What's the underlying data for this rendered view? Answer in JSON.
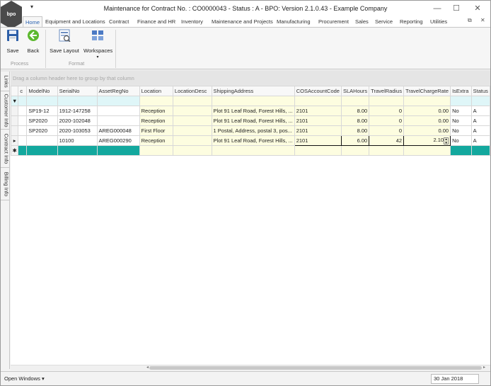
{
  "window": {
    "title": "Maintenance for Contract No. : CO0000043 - Status : A - BPO: Version 2.1.0.43 - Example Company",
    "logo_text": "bpo",
    "minimize_glyph": "—",
    "maximize_glyph": "☐",
    "close_glyph": "✕",
    "qat_glyph": "▾"
  },
  "ribbon_tabs": [
    {
      "label": "Home"
    },
    {
      "label": "Equipment and Locations"
    },
    {
      "label": "Contract"
    },
    {
      "label": "Finance and HR"
    },
    {
      "label": "Inventory"
    },
    {
      "label": "Maintenance and Projects"
    },
    {
      "label": "Manufacturing"
    },
    {
      "label": "Procurement"
    },
    {
      "label": "Sales"
    },
    {
      "label": "Service"
    },
    {
      "label": "Reporting"
    },
    {
      "label": "Utilities"
    }
  ],
  "ribbon_right": {
    "restore_glyph": "⧉",
    "close_glyph": "✕"
  },
  "ribbon": {
    "save_label": "Save",
    "back_label": "Back",
    "save_layout_label": "Save Layout",
    "workspaces_label": "Workspaces",
    "workspaces_glyph": "▾",
    "group_process": "Process",
    "group_format": "Format"
  },
  "side_tabs": [
    {
      "label": "Links"
    },
    {
      "label": "Customer Info"
    },
    {
      "label": "Contract Info"
    },
    {
      "label": "Billing Info"
    }
  ],
  "grid": {
    "group_hint": "Drag a column header here to group by that column",
    "filter_icon": "▼",
    "headers": {
      "c": "c",
      "model": "ModelNo",
      "serial": "SerialNo",
      "asset": "AssetRegNo",
      "location": "Location",
      "locdesc": "LocationDesc",
      "shipping": "ShippingAddress",
      "cos": "COSAccountCode",
      "sla": "SLAHours",
      "radius": "TravelRadius",
      "rate": "TravelChargeRate",
      "extra": "IsExtra",
      "status": "Status"
    },
    "rows": [
      {
        "indicator": "",
        "model": "SP19-12",
        "serial": "1912-147258",
        "asset": "",
        "location": "Reception",
        "locdesc": "",
        "shipping": "Plot 91 Leaf Road, Forest Hills, ...",
        "cos": "2101",
        "sla": "8.00",
        "radius": "0",
        "rate": "0.00",
        "extra": "No",
        "status": "A"
      },
      {
        "indicator": "",
        "model": "SP2020",
        "serial": "2020-102048",
        "asset": "",
        "location": "Reception",
        "locdesc": "",
        "shipping": "Plot 91 Leaf Road, Forest Hills, ...",
        "cos": "2101",
        "sla": "8.00",
        "radius": "0",
        "rate": "0.00",
        "extra": "No",
        "status": "A"
      },
      {
        "indicator": "",
        "model": "SP2020",
        "serial": "2020-103053",
        "asset": "AREG000048",
        "location": "First Floor",
        "locdesc": "",
        "shipping": "1 Postal, Address, postal 3, pos...",
        "cos": "2101",
        "sla": "8.00",
        "radius": "0",
        "rate": "0.00",
        "extra": "No",
        "status": "A"
      },
      {
        "indicator": "▸",
        "model": "",
        "serial": "10100",
        "asset": "AREG000290",
        "location": "Reception",
        "locdesc": "",
        "shipping": "Plot 91 Leaf Road, Forest Hills, ...",
        "cos": "2101",
        "sla": "6.00",
        "radius": "42",
        "rate": "2.10",
        "extra": "No",
        "status": "A"
      }
    ],
    "new_row_indicator": "✱",
    "spin_up": "▲",
    "spin_down": "▼"
  },
  "scroll": {
    "left_glyph": "◂",
    "right_glyph": "▸"
  },
  "status_bar": {
    "open_windows": "Open Windows ▾",
    "date": "30 Jan 2018"
  },
  "colors": {
    "accent": "#2a61b0",
    "new_row": "#13a89e",
    "filter_row": "#dff6f8",
    "editable_cell": "#fdfde0"
  }
}
